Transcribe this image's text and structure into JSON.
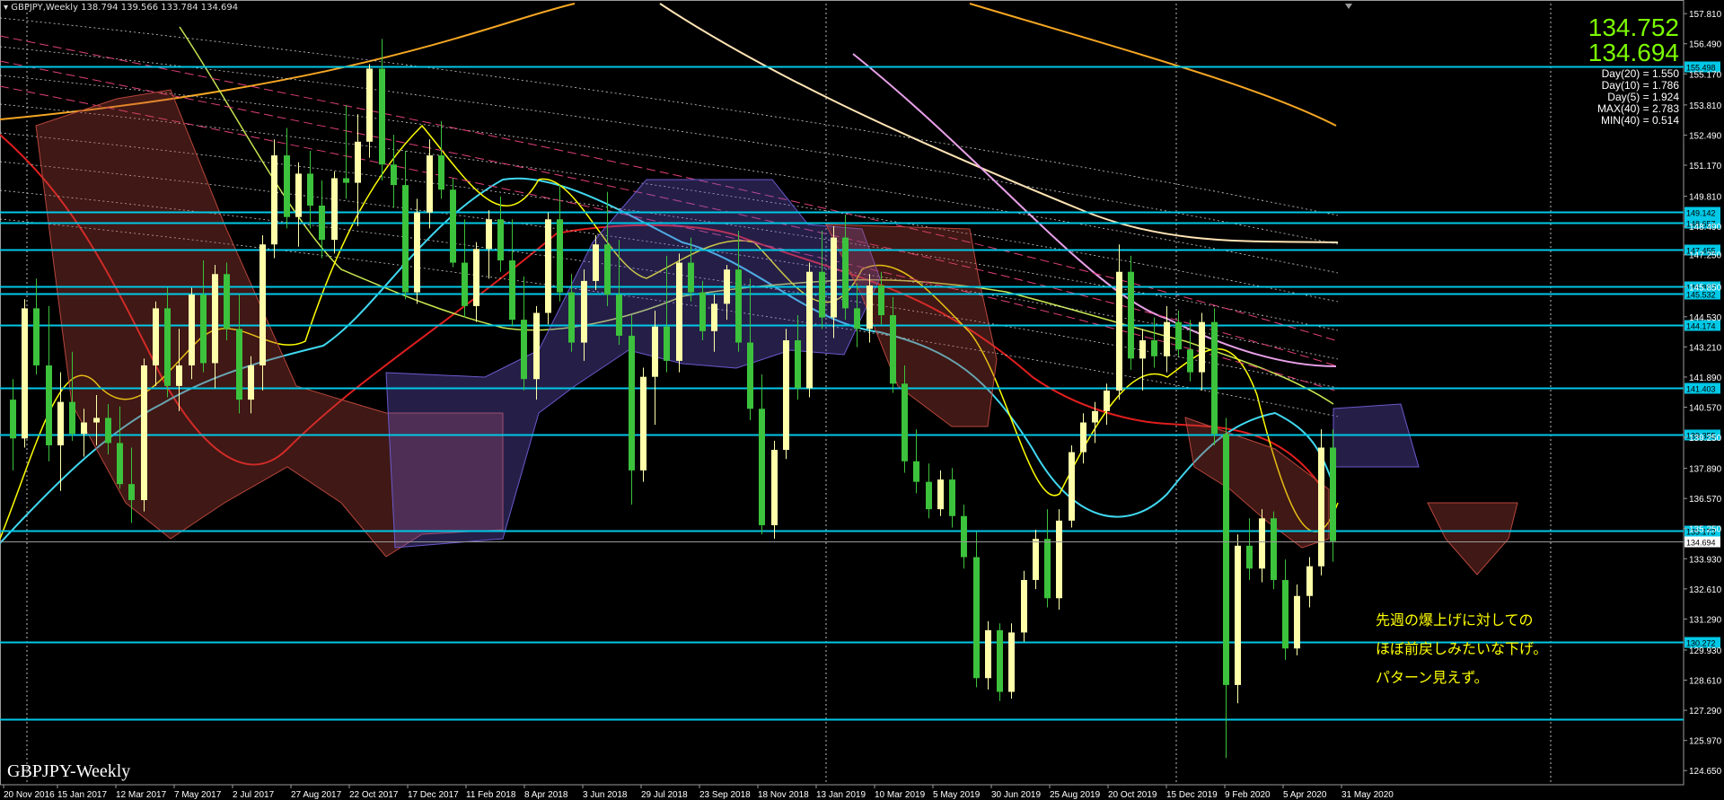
{
  "title_bar": {
    "symbol": "GBPJPY,Weekly",
    "ohlc": "138.794 139.566 133.784 134.694"
  },
  "quote": {
    "bid": "134.752",
    "ask": "134.694"
  },
  "stats": [
    "Day(20) = 1.550",
    "Day(10) = 1.786",
    "Day(5) = 1.924",
    "MAX(40) = 2.783",
    "MIN(40) = 0.514"
  ],
  "watermark": "GBPJPY-Weekly",
  "annotation": [
    "先週の爆上げに対しての",
    "ほぼ前戻しみたいな下げ。",
    "パターン見えず。"
  ],
  "colors": {
    "background": "#000000",
    "bull_candle": "#ffffaa",
    "bear_candle": "#3cc23c",
    "hline": "#00c8e6",
    "axis_text": "#ffffff",
    "price_tag_bg": "#00c8e6",
    "current_tag_bg": "#ffffff"
  },
  "chart_data": {
    "type": "candlestick",
    "ylim": [
      124.03,
      158.25
    ],
    "y_ticks": [
      "157.810",
      "156.490",
      "155.170",
      "153.810",
      "152.490",
      "151.170",
      "149.810",
      "148.490",
      "147.250",
      "145.850",
      "144.530",
      "143.210",
      "141.890",
      "140.570",
      "139.250",
      "137.890",
      "136.570",
      "135.250",
      "133.930",
      "132.610",
      "131.290",
      "129.930",
      "128.610",
      "127.290",
      "125.970",
      "124.650"
    ],
    "x_ticks": [
      "20 Nov 2016",
      "15 Jan 2017",
      "12 Mar 2017",
      "7 May 2017",
      "2 Jul 2017",
      "27 Aug 2017",
      "22 Oct 2017",
      "17 Dec 2017",
      "11 Feb 2018",
      "8 Apr 2018",
      "3 Jun 2018",
      "29 Jul 2018",
      "23 Sep 2018",
      "18 Nov 2018",
      "13 Jan 2019",
      "10 Mar 2019",
      "5 May 2019",
      "30 Jun 2019",
      "25 Aug 2019",
      "20 Oct 2019",
      "15 Dec 2019",
      "9 Feb 2020",
      "5 Apr 2020",
      "31 May 2020"
    ],
    "hlines": [
      {
        "price": 155.498,
        "label": "155.498"
      },
      {
        "price": 149.142,
        "label": "149.142"
      },
      {
        "price": 148.657,
        "label": "148.657"
      },
      {
        "price": 147.455,
        "label": "147.455"
      },
      {
        "price": 145.862,
        "label": "145.862"
      },
      {
        "price": 145.532,
        "label": "145.532"
      },
      {
        "price": 144.174,
        "label": "144.174"
      },
      {
        "price": 141.403,
        "label": "141.403"
      },
      {
        "price": 139.355,
        "label": "139.355"
      },
      {
        "price": 135.173,
        "label": "135.173"
      },
      {
        "price": 130.272,
        "label": "130.272"
      },
      {
        "price": 126.9,
        "label": ""
      }
    ],
    "current_price": {
      "price": 134.694,
      "label": "134.694"
    },
    "candles_ohlc": [
      [
        140.9,
        141.8,
        137.8,
        139.2
      ],
      [
        139.2,
        145.3,
        138.8,
        144.9
      ],
      [
        144.9,
        146.2,
        142.0,
        142.4
      ],
      [
        142.4,
        145.0,
        138.2,
        138.9
      ],
      [
        138.9,
        142.1,
        136.9,
        140.8
      ],
      [
        140.8,
        143.0,
        139.1,
        139.4
      ],
      [
        139.4,
        140.5,
        138.4,
        139.9
      ],
      [
        139.9,
        141.1,
        138.9,
        140.1
      ],
      [
        140.1,
        140.7,
        138.5,
        139.0
      ],
      [
        139.0,
        140.6,
        137.0,
        137.2
      ],
      [
        137.2,
        138.8,
        135.5,
        136.5
      ],
      [
        136.5,
        142.7,
        136.0,
        142.4
      ],
      [
        142.4,
        145.2,
        141.5,
        144.9
      ],
      [
        144.9,
        145.8,
        141.0,
        141.5
      ],
      [
        141.5,
        144.0,
        140.4,
        142.4
      ],
      [
        142.4,
        145.8,
        141.8,
        145.5
      ],
      [
        145.5,
        147.0,
        142.1,
        142.5
      ],
      [
        142.5,
        146.8,
        141.4,
        146.4
      ],
      [
        146.4,
        146.9,
        143.5,
        144.0
      ],
      [
        144.0,
        145.5,
        140.3,
        140.9
      ],
      [
        140.9,
        142.8,
        140.3,
        142.4
      ],
      [
        142.4,
        148.1,
        141.3,
        147.7
      ],
      [
        147.7,
        152.3,
        147.1,
        151.6
      ],
      [
        151.6,
        152.8,
        148.4,
        148.9
      ],
      [
        148.9,
        151.3,
        147.6,
        150.8
      ],
      [
        150.8,
        151.8,
        148.4,
        149.4
      ],
      [
        149.4,
        150.5,
        147.1,
        147.9
      ],
      [
        147.9,
        150.9,
        147.3,
        150.6
      ],
      [
        150.6,
        153.8,
        149.7,
        150.4
      ],
      [
        150.4,
        153.4,
        148.5,
        152.2
      ],
      [
        152.2,
        155.6,
        151.5,
        155.4
      ],
      [
        155.4,
        156.7,
        150.5,
        151.2
      ],
      [
        151.2,
        152.5,
        149.3,
        150.3
      ],
      [
        150.3,
        151.8,
        145.3,
        145.6
      ],
      [
        145.6,
        149.7,
        145.1,
        149.1
      ],
      [
        149.1,
        152.3,
        148.4,
        151.6
      ],
      [
        151.6,
        153.1,
        149.7,
        150.1
      ],
      [
        150.1,
        150.6,
        146.7,
        146.9
      ],
      [
        146.9,
        148.8,
        144.5,
        145.0
      ],
      [
        145.0,
        147.8,
        144.3,
        147.5
      ],
      [
        147.5,
        149.2,
        146.2,
        148.8
      ],
      [
        148.8,
        149.8,
        146.5,
        147.0
      ],
      [
        147.0,
        148.8,
        144.1,
        144.4
      ],
      [
        144.4,
        146.3,
        141.3,
        141.8
      ],
      [
        141.8,
        145.0,
        140.9,
        144.7
      ],
      [
        144.7,
        149.1,
        144.2,
        148.8
      ],
      [
        148.8,
        150.3,
        145.2,
        145.6
      ],
      [
        145.6,
        146.4,
        143.0,
        143.4
      ],
      [
        143.4,
        146.6,
        142.6,
        146.1
      ],
      [
        146.1,
        148.1,
        145.7,
        147.7
      ],
      [
        147.7,
        150.0,
        145.0,
        145.5
      ],
      [
        145.5,
        147.9,
        143.3,
        143.7
      ],
      [
        143.7,
        144.6,
        136.3,
        137.8
      ],
      [
        137.8,
        142.3,
        137.3,
        141.9
      ],
      [
        141.9,
        144.8,
        139.8,
        144.1
      ],
      [
        144.1,
        147.2,
        142.1,
        142.6
      ],
      [
        142.6,
        147.3,
        142.1,
        146.9
      ],
      [
        146.9,
        148.0,
        145.2,
        145.6
      ],
      [
        145.6,
        146.1,
        143.5,
        143.9
      ],
      [
        143.9,
        145.5,
        143.0,
        145.1
      ],
      [
        145.1,
        146.8,
        144.4,
        146.6
      ],
      [
        146.6,
        148.3,
        143.0,
        143.4
      ],
      [
        143.4,
        146.2,
        140.0,
        140.5
      ],
      [
        140.5,
        142.0,
        135.0,
        135.4
      ],
      [
        135.4,
        139.1,
        134.8,
        138.7
      ],
      [
        138.7,
        144.0,
        138.3,
        143.5
      ],
      [
        143.5,
        144.6,
        140.9,
        141.4
      ],
      [
        141.4,
        146.9,
        141.0,
        146.5
      ],
      [
        146.5,
        148.3,
        144.0,
        144.5
      ],
      [
        144.5,
        148.5,
        143.6,
        148.0
      ],
      [
        148.0,
        149.0,
        144.4,
        144.9
      ],
      [
        144.9,
        146.0,
        143.2,
        144.0
      ],
      [
        144.0,
        146.4,
        143.4,
        145.9
      ],
      [
        145.9,
        146.5,
        144.2,
        144.6
      ],
      [
        144.6,
        145.4,
        141.2,
        141.6
      ],
      [
        141.6,
        142.4,
        137.7,
        138.2
      ],
      [
        138.2,
        139.6,
        136.8,
        137.3
      ],
      [
        137.3,
        138.1,
        135.7,
        136.1
      ],
      [
        136.1,
        137.8,
        135.8,
        137.4
      ],
      [
        137.4,
        137.9,
        135.3,
        135.8
      ],
      [
        135.8,
        136.3,
        133.5,
        134.0
      ],
      [
        134.0,
        135.1,
        128.3,
        128.7
      ],
      [
        128.7,
        131.2,
        128.2,
        130.8
      ],
      [
        130.8,
        131.1,
        127.7,
        128.1
      ],
      [
        128.1,
        131.1,
        127.8,
        130.7
      ],
      [
        130.7,
        133.4,
        130.3,
        133.0
      ],
      [
        133.0,
        135.2,
        132.6,
        134.8
      ],
      [
        134.8,
        136.1,
        131.8,
        132.2
      ],
      [
        132.2,
        136.1,
        131.7,
        135.6
      ],
      [
        135.6,
        138.9,
        135.3,
        138.6
      ],
      [
        138.6,
        140.3,
        138.1,
        139.9
      ],
      [
        139.9,
        140.8,
        139.0,
        140.4
      ],
      [
        140.4,
        141.6,
        139.8,
        141.3
      ],
      [
        141.3,
        147.7,
        140.9,
        146.5
      ],
      [
        146.5,
        147.2,
        142.2,
        142.7
      ],
      [
        142.7,
        144.0,
        141.3,
        143.5
      ],
      [
        143.5,
        144.5,
        142.3,
        142.8
      ],
      [
        142.8,
        145.0,
        142.1,
        144.3
      ],
      [
        144.3,
        144.8,
        142.8,
        143.1
      ],
      [
        143.1,
        144.4,
        141.7,
        142.1
      ],
      [
        142.1,
        144.7,
        141.3,
        144.3
      ],
      [
        144.3,
        144.9,
        138.9,
        139.4
      ],
      [
        139.4,
        140.1,
        125.2,
        128.4
      ],
      [
        128.4,
        135.0,
        127.6,
        134.5
      ],
      [
        134.5,
        135.7,
        133.0,
        133.5
      ],
      [
        133.5,
        136.1,
        132.9,
        135.7
      ],
      [
        135.7,
        136.0,
        132.6,
        133.0
      ],
      [
        133.0,
        133.9,
        129.5,
        130.0
      ],
      [
        130.0,
        132.8,
        129.7,
        132.3
      ],
      [
        132.3,
        134.0,
        131.8,
        133.6
      ],
      [
        133.6,
        139.6,
        133.2,
        138.8
      ],
      [
        138.8,
        139.6,
        133.8,
        134.7
      ]
    ]
  }
}
